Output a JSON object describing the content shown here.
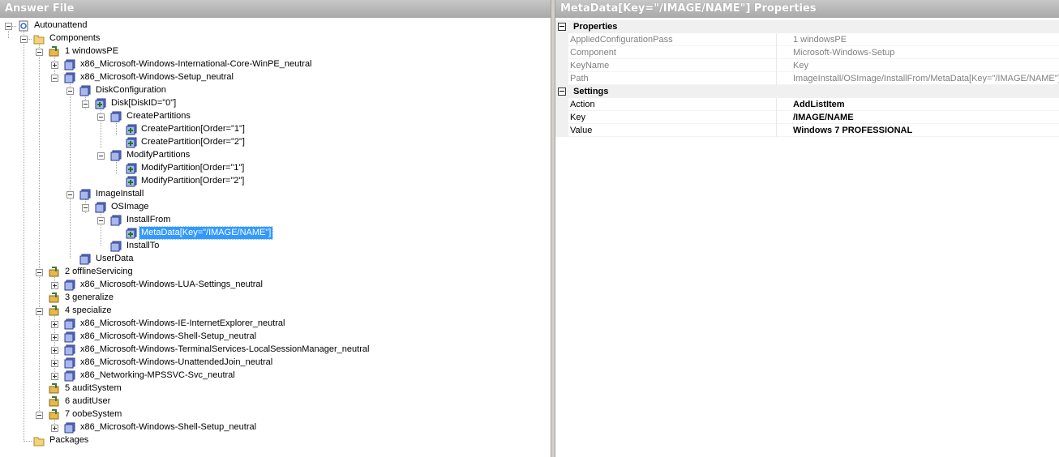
{
  "left_pane": {
    "title": "Answer File"
  },
  "right_pane": {
    "title": "MetaData[Key=\"/IMAGE/NAME\"] Properties"
  },
  "tree": {
    "root": "Autounattend",
    "components": "Components",
    "windowsPE": "1 windowsPE",
    "intl_core": "x86_Microsoft-Windows-International-Core-WinPE_neutral",
    "setup": "x86_Microsoft-Windows-Setup_neutral",
    "disk_config": "DiskConfiguration",
    "disk": "Disk[DiskID=\"0\"]",
    "create_partitions": "CreatePartitions",
    "create_p1": "CreatePartition[Order=\"1\"]",
    "create_p2": "CreatePartition[Order=\"2\"]",
    "modify_partitions": "ModifyPartitions",
    "modify_p1": "ModifyPartition[Order=\"1\"]",
    "modify_p2": "ModifyPartition[Order=\"2\"]",
    "image_install": "ImageInstall",
    "os_image": "OSImage",
    "install_from": "InstallFrom",
    "metadata": "MetaData[Key=\"/IMAGE/NAME\"]",
    "install_to": "InstallTo",
    "user_data": "UserData",
    "offline_servicing": "2 offlineServicing",
    "lua_settings": "x86_Microsoft-Windows-LUA-Settings_neutral",
    "generalize": "3 generalize",
    "specialize": "4 specialize",
    "ie": "x86_Microsoft-Windows-IE-InternetExplorer_neutral",
    "shell_setup_spec": "x86_Microsoft-Windows-Shell-Setup_neutral",
    "ts_lsm": "x86_Microsoft-Windows-TerminalServices-LocalSessionManager_neutral",
    "unattended_join": "x86_Microsoft-Windows-UnattendedJoin_neutral",
    "mpssvc": "x86_Networking-MPSSVC-Svc_neutral",
    "audit_system": "5 auditSystem",
    "audit_user": "6 auditUser",
    "oobe_system": "7 oobeSystem",
    "shell_setup_oobe": "x86_Microsoft-Windows-Shell-Setup_neutral",
    "packages": "Packages"
  },
  "properties": {
    "cat_properties": "Properties",
    "applied_pass_name": "AppliedConfigurationPass",
    "applied_pass_value": "1 windowsPE",
    "component_name": "Component",
    "component_value": "Microsoft-Windows-Setup",
    "keyname_name": "KeyName",
    "keyname_value": "Key",
    "path_name": "Path",
    "path_value": "ImageInstall/OSImage/InstallFrom/MetaData[Key=\"/IMAGE/NAME\"]",
    "cat_settings": "Settings",
    "action_name": "Action",
    "action_value": "AddListItem",
    "key_name": "Key",
    "key_value": "/IMAGE/NAME",
    "value_name": "Value",
    "value_value": "Windows 7 PROFESSIONAL"
  },
  "colors": {
    "selection": "#3399ff",
    "header_gradient_top": "#c7c7c7",
    "header_gradient_bottom": "#a9a9a9"
  }
}
